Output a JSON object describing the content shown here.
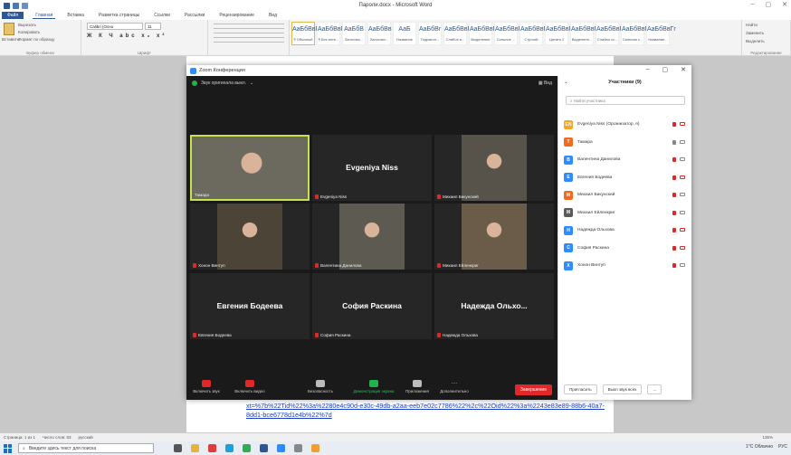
{
  "word": {
    "title": "Пароли.docx - Microsoft Word",
    "tabs": [
      "Файл",
      "Главная",
      "Вставка",
      "Разметка страницы",
      "Ссылки",
      "Рассылки",
      "Рецензирование",
      "Вид"
    ],
    "clipboard": {
      "cut": "Вырезать",
      "copy": "Копировать",
      "paste": "Вставить",
      "format_painter": "Формат по образцу",
      "label": "Буфер обмена"
    },
    "font": {
      "family": "Calibri (Осно",
      "size": "11",
      "label": "Шрифт"
    },
    "styles": [
      {
        "sample": "AaБбВвГг",
        "name": "¶ Обычный"
      },
      {
        "sample": "AaБбВвГг",
        "name": "¶ Без инте..."
      },
      {
        "sample": "AaБбВ",
        "name": "Заголово..."
      },
      {
        "sample": "AaБбВв",
        "name": "Заголово..."
      },
      {
        "sample": "AaБ",
        "name": "Название"
      },
      {
        "sample": "AaБбВг",
        "name": "Подзагол..."
      },
      {
        "sample": "AaБбВвГг",
        "name": "Слабое в..."
      },
      {
        "sample": "AaБбВвГг",
        "name": "Выделение"
      },
      {
        "sample": "AaБбВвГг",
        "name": "Сильное ..."
      },
      {
        "sample": "AaБбВвГг",
        "name": "Строгий"
      },
      {
        "sample": "AaБбВвГг",
        "name": "Цитата 2"
      },
      {
        "sample": "AaБбВвГг",
        "name": "Выделенн..."
      },
      {
        "sample": "AaБбВвГг",
        "name": "Слабая сс..."
      },
      {
        "sample": "AaБбВвГг",
        "name": "Сильная с..."
      },
      {
        "sample": "AaБбВвГг",
        "name": "Название..."
      }
    ],
    "edit": {
      "find": "Найти",
      "replace": "Заменить",
      "select": "Выделить",
      "label": "Редактирование",
      "change_styles": "Изменить стили"
    },
    "doc_text": "xt=%7b%22Tid%22%3a%2280e4c90d-e30c-49db-a2aa-eeb7e02c7786%22%2c%22Oid%22%3a%2243e83e89-88b6-40a7-8dd1-bce6778d1e4b%22%7d",
    "status": {
      "page": "Страница: 1 из 1",
      "words": "Число слов: 83",
      "lang": "русский",
      "zoom": "135%"
    }
  },
  "taskbar": {
    "search_placeholder": "Введите здесь текст для поиска",
    "weather": "1°C Облачно",
    "lang": "РУС"
  },
  "zoom": {
    "title": "Zoom Конференция",
    "original_sound": "Звук оригинала выкл.",
    "view": "Вид",
    "tiles": [
      {
        "name": "Тамара",
        "big": "",
        "video": true,
        "active": true,
        "muted": false
      },
      {
        "name": "Evgeniya Niss",
        "big": "Evgeniya Niss",
        "video": false,
        "active": false,
        "muted": true
      },
      {
        "name": "Михаил Бикунский",
        "big": "",
        "video": true,
        "active": false,
        "muted": true
      },
      {
        "name": "Хонон Винтуп",
        "big": "",
        "video": true,
        "active": false,
        "muted": true
      },
      {
        "name": "Валентина Данилова",
        "big": "",
        "video": true,
        "active": false,
        "muted": true
      },
      {
        "name": "Михаил Ейленкриг",
        "big": "",
        "video": true,
        "active": false,
        "muted": true
      },
      {
        "name": "Евгения Бодеева",
        "big": "Евгения Бодеева",
        "video": false,
        "active": false,
        "muted": true
      },
      {
        "name": "София Раскина",
        "big": "София Раскина",
        "video": false,
        "active": false,
        "muted": true
      },
      {
        "name": "Надежда Ольхова",
        "big": "Надежда Ольхо...",
        "video": false,
        "active": false,
        "muted": true
      }
    ],
    "toolbar": {
      "unmute": "Включить звук",
      "start_video": "Включить видео",
      "security": "Безопасность",
      "share": "Демонстрация экрана",
      "apps": "Приложения",
      "more": "Дополнительно",
      "end": "Завершение"
    },
    "panel": {
      "title": "Участники (9)",
      "search_placeholder": "Найти участника",
      "participants": [
        {
          "initials": "EN",
          "name": "Evgeniya Niss (Организатор, я)",
          "color": "#f5a623",
          "mic_on": false,
          "cam_on": false
        },
        {
          "initials": "T",
          "name": "Тамара",
          "color": "#f26b1d",
          "mic_on": true,
          "cam_on": true
        },
        {
          "initials": "В",
          "name": "Валентина Данилова",
          "color": "#2d8cff",
          "mic_on": false,
          "cam_on": true
        },
        {
          "initials": "Е",
          "name": "Евгения Бодеева",
          "color": "#2d8cff",
          "mic_on": false,
          "cam_on": false
        },
        {
          "initials": "М",
          "name": "Михаил Бикунский",
          "color": "#f26b1d",
          "mic_on": false,
          "cam_on": true
        },
        {
          "initials": "М",
          "name": "Михаил Ейленкриг",
          "color": "#5a5a5a",
          "mic_on": false,
          "cam_on": true
        },
        {
          "initials": "Н",
          "name": "Надежда Ольхова",
          "color": "#2d8cff",
          "mic_on": false,
          "cam_on": false
        },
        {
          "initials": "С",
          "name": "София Раскина",
          "color": "#2d8cff",
          "mic_on": false,
          "cam_on": false
        },
        {
          "initials": "Х",
          "name": "Хонон Винтуп",
          "color": "#2d8cff",
          "mic_on": false,
          "cam_on": true
        }
      ],
      "invite": "Пригласить",
      "mute_all": "Выкл звук всех",
      "more": "..."
    }
  }
}
